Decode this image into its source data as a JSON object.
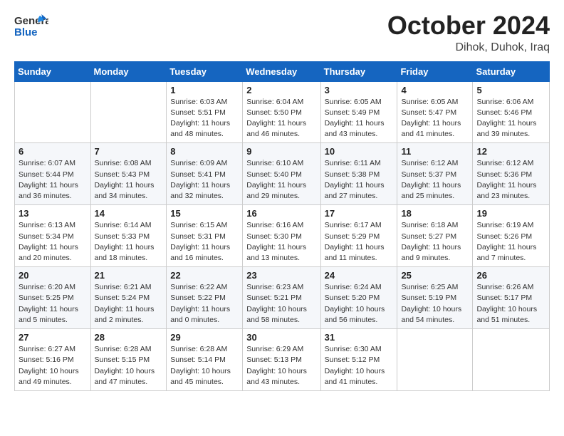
{
  "header": {
    "logo_general": "General",
    "logo_blue": "Blue",
    "month_title": "October 2024",
    "location": "Dihok, Duhok, Iraq"
  },
  "weekdays": [
    "Sunday",
    "Monday",
    "Tuesday",
    "Wednesday",
    "Thursday",
    "Friday",
    "Saturday"
  ],
  "weeks": [
    [
      {
        "day": "",
        "detail": ""
      },
      {
        "day": "",
        "detail": ""
      },
      {
        "day": "1",
        "detail": "Sunrise: 6:03 AM\nSunset: 5:51 PM\nDaylight: 11 hours and 48 minutes."
      },
      {
        "day": "2",
        "detail": "Sunrise: 6:04 AM\nSunset: 5:50 PM\nDaylight: 11 hours and 46 minutes."
      },
      {
        "day": "3",
        "detail": "Sunrise: 6:05 AM\nSunset: 5:49 PM\nDaylight: 11 hours and 43 minutes."
      },
      {
        "day": "4",
        "detail": "Sunrise: 6:05 AM\nSunset: 5:47 PM\nDaylight: 11 hours and 41 minutes."
      },
      {
        "day": "5",
        "detail": "Sunrise: 6:06 AM\nSunset: 5:46 PM\nDaylight: 11 hours and 39 minutes."
      }
    ],
    [
      {
        "day": "6",
        "detail": "Sunrise: 6:07 AM\nSunset: 5:44 PM\nDaylight: 11 hours and 36 minutes."
      },
      {
        "day": "7",
        "detail": "Sunrise: 6:08 AM\nSunset: 5:43 PM\nDaylight: 11 hours and 34 minutes."
      },
      {
        "day": "8",
        "detail": "Sunrise: 6:09 AM\nSunset: 5:41 PM\nDaylight: 11 hours and 32 minutes."
      },
      {
        "day": "9",
        "detail": "Sunrise: 6:10 AM\nSunset: 5:40 PM\nDaylight: 11 hours and 29 minutes."
      },
      {
        "day": "10",
        "detail": "Sunrise: 6:11 AM\nSunset: 5:38 PM\nDaylight: 11 hours and 27 minutes."
      },
      {
        "day": "11",
        "detail": "Sunrise: 6:12 AM\nSunset: 5:37 PM\nDaylight: 11 hours and 25 minutes."
      },
      {
        "day": "12",
        "detail": "Sunrise: 6:12 AM\nSunset: 5:36 PM\nDaylight: 11 hours and 23 minutes."
      }
    ],
    [
      {
        "day": "13",
        "detail": "Sunrise: 6:13 AM\nSunset: 5:34 PM\nDaylight: 11 hours and 20 minutes."
      },
      {
        "day": "14",
        "detail": "Sunrise: 6:14 AM\nSunset: 5:33 PM\nDaylight: 11 hours and 18 minutes."
      },
      {
        "day": "15",
        "detail": "Sunrise: 6:15 AM\nSunset: 5:31 PM\nDaylight: 11 hours and 16 minutes."
      },
      {
        "day": "16",
        "detail": "Sunrise: 6:16 AM\nSunset: 5:30 PM\nDaylight: 11 hours and 13 minutes."
      },
      {
        "day": "17",
        "detail": "Sunrise: 6:17 AM\nSunset: 5:29 PM\nDaylight: 11 hours and 11 minutes."
      },
      {
        "day": "18",
        "detail": "Sunrise: 6:18 AM\nSunset: 5:27 PM\nDaylight: 11 hours and 9 minutes."
      },
      {
        "day": "19",
        "detail": "Sunrise: 6:19 AM\nSunset: 5:26 PM\nDaylight: 11 hours and 7 minutes."
      }
    ],
    [
      {
        "day": "20",
        "detail": "Sunrise: 6:20 AM\nSunset: 5:25 PM\nDaylight: 11 hours and 5 minutes."
      },
      {
        "day": "21",
        "detail": "Sunrise: 6:21 AM\nSunset: 5:24 PM\nDaylight: 11 hours and 2 minutes."
      },
      {
        "day": "22",
        "detail": "Sunrise: 6:22 AM\nSunset: 5:22 PM\nDaylight: 11 hours and 0 minutes."
      },
      {
        "day": "23",
        "detail": "Sunrise: 6:23 AM\nSunset: 5:21 PM\nDaylight: 10 hours and 58 minutes."
      },
      {
        "day": "24",
        "detail": "Sunrise: 6:24 AM\nSunset: 5:20 PM\nDaylight: 10 hours and 56 minutes."
      },
      {
        "day": "25",
        "detail": "Sunrise: 6:25 AM\nSunset: 5:19 PM\nDaylight: 10 hours and 54 minutes."
      },
      {
        "day": "26",
        "detail": "Sunrise: 6:26 AM\nSunset: 5:17 PM\nDaylight: 10 hours and 51 minutes."
      }
    ],
    [
      {
        "day": "27",
        "detail": "Sunrise: 6:27 AM\nSunset: 5:16 PM\nDaylight: 10 hours and 49 minutes."
      },
      {
        "day": "28",
        "detail": "Sunrise: 6:28 AM\nSunset: 5:15 PM\nDaylight: 10 hours and 47 minutes."
      },
      {
        "day": "29",
        "detail": "Sunrise: 6:28 AM\nSunset: 5:14 PM\nDaylight: 10 hours and 45 minutes."
      },
      {
        "day": "30",
        "detail": "Sunrise: 6:29 AM\nSunset: 5:13 PM\nDaylight: 10 hours and 43 minutes."
      },
      {
        "day": "31",
        "detail": "Sunrise: 6:30 AM\nSunset: 5:12 PM\nDaylight: 10 hours and 41 minutes."
      },
      {
        "day": "",
        "detail": ""
      },
      {
        "day": "",
        "detail": ""
      }
    ]
  ]
}
